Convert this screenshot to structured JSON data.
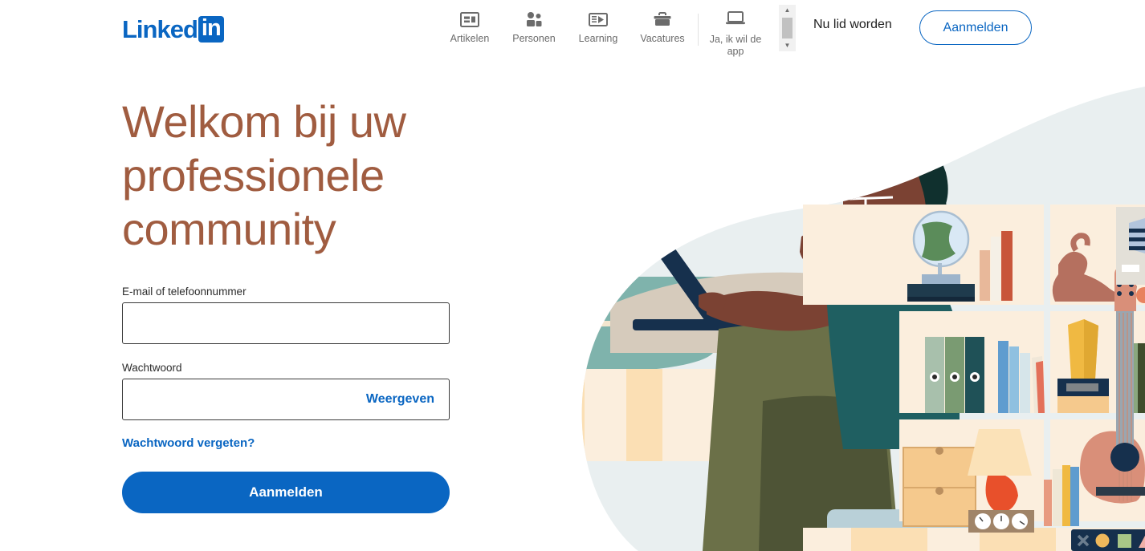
{
  "brand": {
    "logo_word": "Linked",
    "logo_badge": "in",
    "accent_blue": "#0a66c2",
    "hero_color": "#a05c40"
  },
  "header": {
    "nav_items": [
      {
        "label": "Artikelen",
        "icon": "article-icon"
      },
      {
        "label": "Personen",
        "icon": "people-icon"
      },
      {
        "label": "Learning",
        "icon": "learning-video-icon"
      },
      {
        "label": "Vacatures",
        "icon": "briefcase-icon"
      }
    ],
    "app_promo": {
      "label": "Ja, ik wil de app",
      "icon": "laptop-icon"
    },
    "join_label": "Nu lid worden",
    "signin_label": "Aanmelden",
    "scrollbar": {
      "up": "▲",
      "down": "▼"
    }
  },
  "main": {
    "headline": "Welkom bij uw professionele community",
    "email": {
      "label": "E-mail of telefoonnummer",
      "value": "",
      "placeholder": ""
    },
    "password": {
      "label": "Wachtwoord",
      "value": "",
      "placeholder": "",
      "show_label": "Weergeven"
    },
    "forgot_label": "Wachtwoord vergeten?",
    "submit_label": "Aanmelden"
  },
  "illustration": {
    "name": "person-working-on-laptop-with-bookshelf",
    "palette": {
      "sky": "#e9eff0",
      "sand": "#fbeedd",
      "shelf_bg": "#fbeedd",
      "teal_water": "#7fb3ac",
      "skin": "#7b4233",
      "hair": "#10302e",
      "shirt": "#1f5f61",
      "pants": "#6b7048",
      "laptop": "#16304d",
      "guitar": "#d98f79",
      "cat": "#b5705f",
      "lamp": "#e8502b",
      "globe_green": "#5b8c5a",
      "dark_panel": "#16304d"
    },
    "objects": [
      "globe",
      "books",
      "cat",
      "ball",
      "binders",
      "vase",
      "guitar",
      "lamp",
      "clocks",
      "drawers",
      "chair",
      "laptop",
      "window"
    ]
  }
}
